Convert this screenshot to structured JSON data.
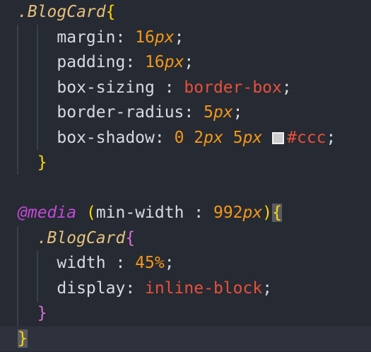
{
  "code": {
    "l1": {
      "selector": ".BlogCard",
      "brace": "{"
    },
    "l2": {
      "prop": "margin: ",
      "num": "16",
      "unit": "px",
      "end": ";"
    },
    "l3": {
      "prop": "padding: ",
      "num": "16",
      "unit": "px",
      "end": ";"
    },
    "l4": {
      "prop": "box-sizing : ",
      "value": "border-box",
      "end": ";"
    },
    "l5": {
      "prop": "border-radius: ",
      "num": "5",
      "unit": "px",
      "end": ";"
    },
    "l6": {
      "prop": "box-shadow: ",
      "n1": "0",
      "n2": "2",
      "u2": "px",
      "n3": "5",
      "u3": "px",
      "color": "#ccc",
      "end": ";"
    },
    "l7": {
      "brace": "}"
    },
    "l9": {
      "at": "@media",
      "open": "(",
      "prop": "min-width : ",
      "num": "992",
      "unit": "px",
      "close": ")",
      "brace": "{"
    },
    "l10": {
      "selector": ".BlogCard",
      "brace": "{"
    },
    "l11": {
      "prop": "width : ",
      "num": "45%",
      "end": ";"
    },
    "l12": {
      "prop": "display: ",
      "value": "inline-block",
      "end": ";"
    },
    "l13": {
      "brace": "}"
    },
    "l14": {
      "brace": "}"
    }
  },
  "colors": {
    "background": "#262a33",
    "selector": "#e5c07b",
    "number": "#f29718",
    "keyword": "#e8503a",
    "at_rule": "#c34ad8",
    "swatch": "#cccccc"
  }
}
